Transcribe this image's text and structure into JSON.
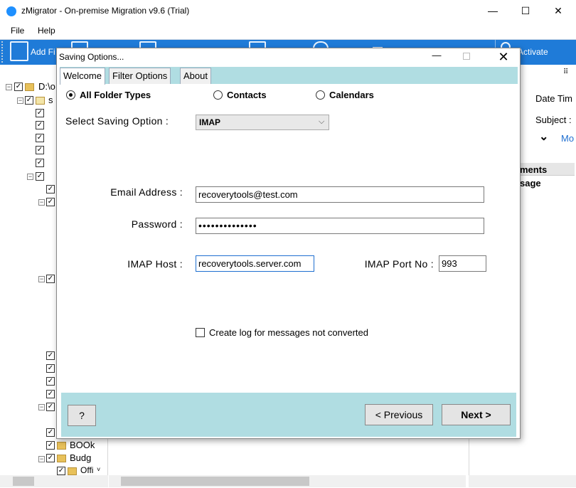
{
  "window": {
    "title": "zMigrator - On-premise Migration v9.6 (Trial)",
    "minimize": "—",
    "maximize": "☐",
    "close": "✕"
  },
  "menu": {
    "file": "File",
    "help": "Help"
  },
  "toolbar": {
    "add_label": "Add Fi",
    "activate_label": "Activate"
  },
  "tree": {
    "root": "D:\\o",
    "child": "s",
    "items": [
      "BOOk",
      "Budg",
      "Offi"
    ]
  },
  "right_pane": {
    "date_label": "Date Tim",
    "subject_label": "Subject :",
    "more_label": "Mo",
    "attachments_header": "ments",
    "message_label": "sage"
  },
  "dialog": {
    "title": "Saving Options...",
    "tabs": [
      "Welcome",
      "Filter Options",
      "About"
    ],
    "radios": {
      "all": "All Folder Types",
      "contacts": "Contacts",
      "calendars": "Calendars"
    },
    "saving_label": "Select Saving Option :",
    "saving_value": "IMAP",
    "email_label": "Email Address :",
    "email_value": "recoverytools@test.com",
    "password_label": "Password :",
    "password_value": "••••••••••••••",
    "host_label": "IMAP Host :",
    "host_value": "recoverytools.server.com",
    "port_label": "IMAP Port No :",
    "port_value": "993",
    "log_label": "Create log for messages not converted",
    "help_button": "?",
    "previous_button": "< Previous",
    "next_button": "Next >"
  },
  "colors": {
    "accent": "#1f7bd8",
    "panel": "#b0dde2"
  }
}
